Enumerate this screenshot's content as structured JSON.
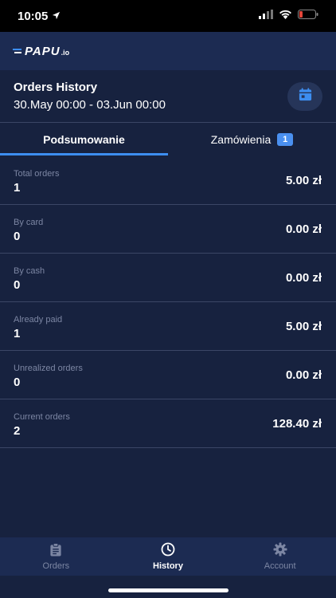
{
  "status_bar": {
    "time": "10:05"
  },
  "app": {
    "logo_text": "PAPU",
    "logo_suffix": ".io"
  },
  "history": {
    "title": "Orders History",
    "date_range": "30.May 00:00 - 03.Jun 00:00"
  },
  "tabs": [
    {
      "label": "Podsumowanie",
      "active": true
    },
    {
      "label": "Zamówienia",
      "badge": "1",
      "active": false
    }
  ],
  "summary": [
    {
      "label": "Total orders",
      "count": "1",
      "amount": "5.00 zł"
    },
    {
      "label": "By card",
      "count": "0",
      "amount": "0.00 zł"
    },
    {
      "label": "By cash",
      "count": "0",
      "amount": "0.00 zł"
    },
    {
      "label": "Already paid",
      "count": "1",
      "amount": "5.00 zł"
    },
    {
      "label": "Unrealized orders",
      "count": "0",
      "amount": "0.00 zł"
    },
    {
      "label": "Current orders",
      "count": "2",
      "amount": "128.40 zł"
    }
  ],
  "bottom_nav": [
    {
      "label": "Orders",
      "icon": "clipboard-icon",
      "active": false
    },
    {
      "label": "History",
      "icon": "clock-icon",
      "active": true
    },
    {
      "label": "Account",
      "icon": "gear-icon",
      "active": false
    }
  ],
  "colors": {
    "background": "#17223f",
    "header": "#1c2b52",
    "accent": "#3d8ef0",
    "muted_text": "#7c86a3",
    "battery_low": "#e5463a"
  }
}
